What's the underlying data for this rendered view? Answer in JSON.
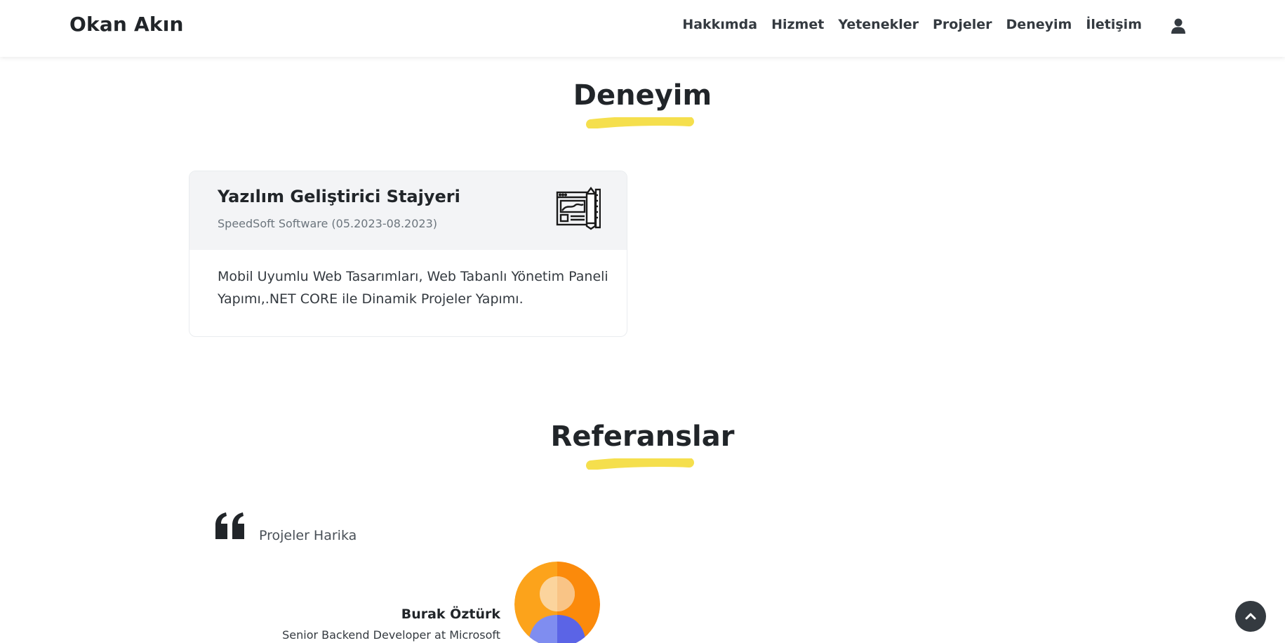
{
  "brand": "Okan Akın",
  "nav": {
    "items": [
      "Hakkımda",
      "Hizmet",
      "Yetenekler",
      "Projeler",
      "Deneyim",
      "İletişim"
    ],
    "user_icon": "user-icon"
  },
  "experience": {
    "title": "Deneyim",
    "accent_color": "#f5df4d",
    "items": [
      {
        "role": "Yazılım Geliştirici Stajyeri",
        "company": "SpeedSoft Software (05.2023-08.2023)",
        "description": "Mobil Uyumlu Web Tasarımları, Web Tabanlı Yönetim Paneli Yapımı,.NET CORE ile Dinamik Projeler Yapımı.",
        "icon": "web-design-icon"
      }
    ]
  },
  "references": {
    "title": "Referanslar",
    "items": [
      {
        "quote": "Projeler Harika",
        "name": "Burak Öztürk",
        "position": "Senior Backend Developer at Microsoft"
      }
    ]
  },
  "back_to_top_icon": "chevron-up-icon"
}
